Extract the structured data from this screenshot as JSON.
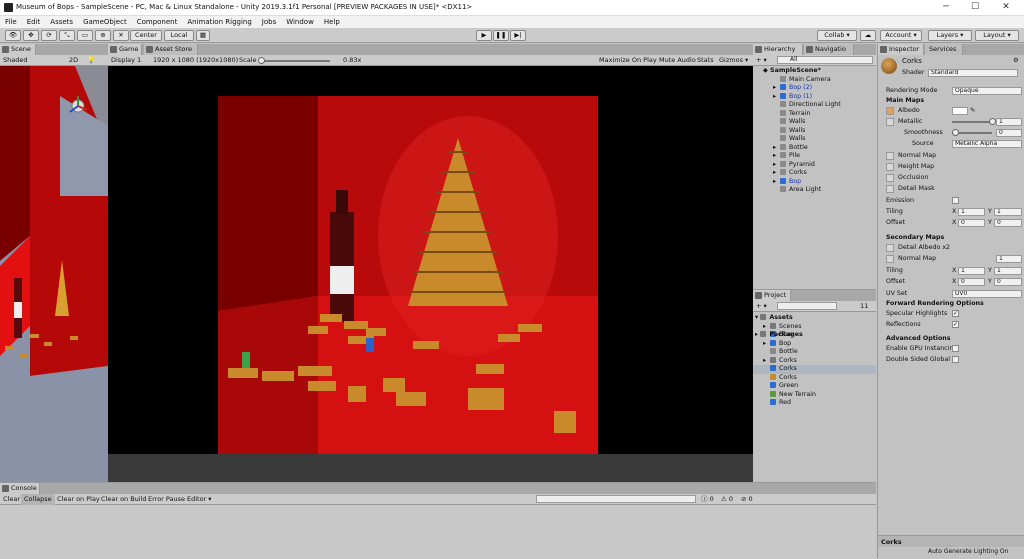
{
  "window": {
    "title": "Museum of Bops - SampleScene - PC, Mac & Linux Standalone - Unity 2019.3.1f1 Personal [PREVIEW PACKAGES IN USE]* <DX11>",
    "minimize": "─",
    "maximize": "☐",
    "close": "✕"
  },
  "menu": [
    "File",
    "Edit",
    "Assets",
    "GameObject",
    "Component",
    "Animation Rigging",
    "Jobs",
    "Window",
    "Help"
  ],
  "toolbar": {
    "center": "Center",
    "local": "Local",
    "collab": "Collab ▾",
    "account": "Account ▾",
    "layers": "Layers ▾",
    "layout": "Layout ▾"
  },
  "scene": {
    "tab": "Scene",
    "shading": "Shaded",
    "mode2d": "2D"
  },
  "game": {
    "tab": "Game",
    "tab2": "Asset Store",
    "display": "Display 1",
    "resolution": "1920 x 1080 (1920x1080)",
    "scale_label": "Scale",
    "scale_value": "0.83x",
    "maximize": "Maximize On Play",
    "mute": "Mute Audio",
    "stats": "Stats",
    "gizmos": "Gizmos ▾"
  },
  "hierarchy": {
    "tab": "Hierarchy",
    "tab2": "Navigatio",
    "search_placeholder": "All",
    "scene": "SampleScene*",
    "items": [
      {
        "label": "Main Camera",
        "blue": false,
        "arrow": ""
      },
      {
        "label": "Bop (2)",
        "blue": true,
        "arrow": "▸"
      },
      {
        "label": "Bop (1)",
        "blue": true,
        "arrow": "▸"
      },
      {
        "label": "Directional Light",
        "blue": false,
        "arrow": ""
      },
      {
        "label": "Terrain",
        "blue": false,
        "arrow": ""
      },
      {
        "label": "Walls",
        "blue": false,
        "arrow": ""
      },
      {
        "label": "Walls",
        "blue": false,
        "arrow": ""
      },
      {
        "label": "Walls",
        "blue": false,
        "arrow": ""
      },
      {
        "label": "Bottle",
        "blue": false,
        "arrow": "▸"
      },
      {
        "label": "Pile",
        "blue": false,
        "arrow": "▸"
      },
      {
        "label": "Pyramid",
        "blue": false,
        "arrow": "▸"
      },
      {
        "label": "Corks",
        "blue": false,
        "arrow": "▸"
      },
      {
        "label": "Bop",
        "blue": true,
        "arrow": "▸"
      },
      {
        "label": "Area Light",
        "blue": false,
        "arrow": ""
      }
    ]
  },
  "project": {
    "tab": "Project",
    "count": "11",
    "root": "Assets",
    "packages": "Packages",
    "items": [
      "Scenes",
      "Blue",
      "Bop",
      "Bottle",
      "Corks",
      "Corks",
      "Corks",
      "Green",
      "New Terrain",
      "Red"
    ]
  },
  "inspector": {
    "tab": "Inspector",
    "tab2": "Services",
    "name": "Corks",
    "shader_label": "Shader",
    "shader": "Standard",
    "rendering_mode_label": "Rendering Mode",
    "rendering_mode": "Opaque",
    "main_maps": "Main Maps",
    "albedo": "Albedo",
    "metallic": "Metallic",
    "metallic_value": "1",
    "smoothness": "Smoothness",
    "smoothness_value": "0",
    "source": "Source",
    "source_value": "Metallic Alpha",
    "normal_map": "Normal Map",
    "height_map": "Height Map",
    "occlusion": "Occlusion",
    "detail_mask": "Detail Mask",
    "emission": "Emission",
    "tiling": "Tiling",
    "offset": "Offset",
    "x": "X",
    "y": "Y",
    "tiling_x": "1",
    "tiling_y": "1",
    "offset_x": "0",
    "offset_y": "0",
    "secondary_maps": "Secondary Maps",
    "detail_albedo": "Detail Albedo x2",
    "normal_map2": "Normal Map",
    "normal_value": "1",
    "tiling2_x": "1",
    "tiling2_y": "1",
    "offset2_x": "0",
    "offset2_y": "0",
    "uv_set": "UV Set",
    "uv_value": "UV0",
    "forward": "Forward Rendering Options",
    "specular": "Specular Highlights",
    "reflections": "Reflections",
    "advanced": "Advanced Options",
    "gpu": "Enable GPU Instancir",
    "double": "Double Sided Global I",
    "footer": "Corks",
    "auto": "Auto Generate Lighting On"
  },
  "console": {
    "tab": "Console",
    "clear": "Clear",
    "collapse": "Collapse",
    "clear_on_play": "Clear on Play",
    "clear_on_build": "Clear on Build",
    "error_pause": "Error Pause",
    "editor": "Editor ▾",
    "info_count": "0",
    "warn_count": "0",
    "error_count": "0"
  },
  "colors": {
    "red": "#c40b0b",
    "dark_red": "#4a0000",
    "cork": "#c88a2a",
    "blue_text": "#1436a8",
    "unity_blue": "#2a6bd4"
  }
}
